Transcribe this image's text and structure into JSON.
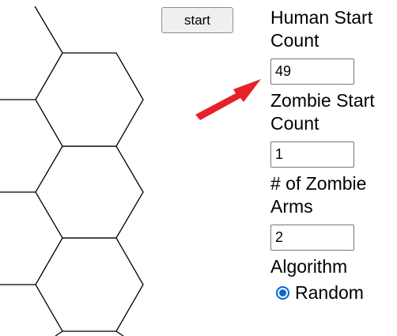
{
  "toolbar": {
    "start_label": "start"
  },
  "controls": {
    "human_start": {
      "label": "Human Start Count",
      "value": "49"
    },
    "zombie_start": {
      "label": "Zombie Start Count",
      "value": "1"
    },
    "zombie_arms": {
      "label": "# of Zombie Arms",
      "value": "2"
    },
    "algorithm": {
      "label": "Algorithm",
      "selected_option": "Random"
    }
  },
  "icons": {
    "annotation_arrow": "red-arrow-icon",
    "radio": "radio-selected-icon"
  },
  "colors": {
    "arrow": "#e8202a",
    "radio": "#0a66d8",
    "hex_stroke": "#000000"
  }
}
